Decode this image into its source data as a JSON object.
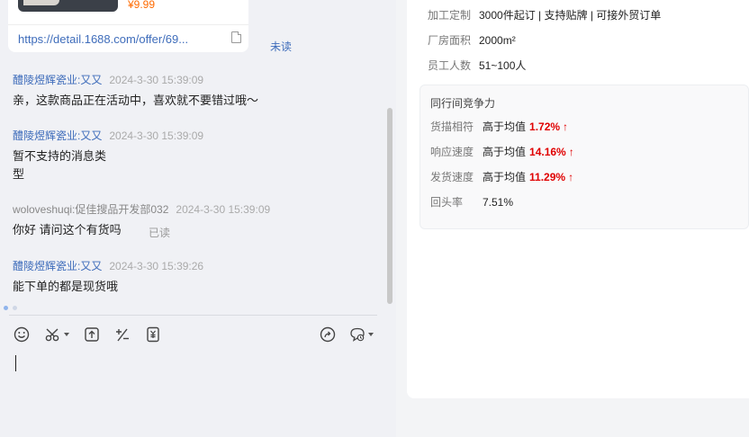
{
  "product_card": {
    "price": "¥9.99",
    "link": "https://detail.1688.com/offer/69...",
    "read_status": "未读"
  },
  "messages": [
    {
      "sender": "醴陵煜辉瓷业:又又",
      "time": "2024-3-30 15:39:09",
      "lines": [
        "亲，这款商品正在活动中，喜欢就不要错过哦～"
      ]
    },
    {
      "sender": "醴陵煜辉瓷业:又又",
      "time": "2024-3-30 15:39:09",
      "lines": [
        "暂不支持的消息类",
        "型"
      ]
    },
    {
      "sender": "woloveshuqi:促佳搜品开发部032",
      "time": "2024-3-30 15:39:09",
      "lines": [
        "你好  请问这个有货吗"
      ],
      "read_status": "已读"
    },
    {
      "sender": "醴陵煜辉瓷业:又又",
      "time": "2024-3-30 15:39:26",
      "lines": [
        "能下单的都是现货哦"
      ]
    }
  ],
  "toolbar_icons": [
    "emoji-icon",
    "scissors-icon",
    "upload-icon",
    "percent-icon",
    "yuan-icon",
    "share-icon",
    "quick-reply-icon"
  ],
  "supplier_info": {
    "rows": [
      {
        "key": "加工定制",
        "value": "3000件起订 | 支持贴牌 | 可接外贸订单"
      },
      {
        "key": "厂房面积",
        "value": "2000m²"
      },
      {
        "key": "员工人数",
        "value": "51~100人"
      }
    ]
  },
  "competitiveness": {
    "title": "同行间竞争力",
    "rows": [
      {
        "key": "货描相符",
        "value": "高于均值",
        "pct": "1.72%",
        "arrow": "↑"
      },
      {
        "key": "响应速度",
        "value": "高于均值",
        "pct": "14.16%",
        "arrow": "↑"
      },
      {
        "key": "发货速度",
        "value": "高于均值",
        "pct": "11.29%",
        "arrow": "↑"
      },
      {
        "key": "回头率",
        "value": "7.51%"
      }
    ]
  },
  "colors": {
    "link": "#3f6dbb",
    "price": "#ff6a00",
    "positive": "#e00000"
  }
}
